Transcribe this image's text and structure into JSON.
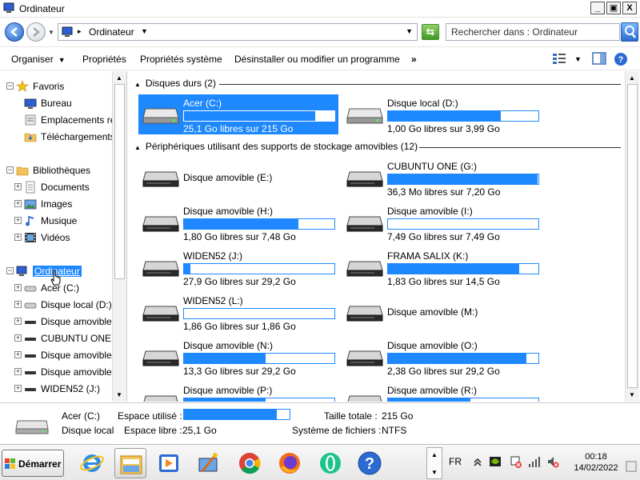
{
  "window": {
    "title": "Ordinateur",
    "minimize": "_",
    "maximize": "▣",
    "close": "X"
  },
  "address": {
    "location": "Ordinateur",
    "search_placeholder": "Rechercher dans : Ordinateur"
  },
  "toolbar": {
    "organize": "Organiser",
    "properties": "Propriétés",
    "system_properties": "Propriétés système",
    "uninstall": "Désinstaller ou modifier un programme",
    "more": "»"
  },
  "nav": {
    "favorites": "Favoris",
    "desktop": "Bureau",
    "recent": "Emplacements récents",
    "downloads": "Téléchargements",
    "libraries": "Bibliothèques",
    "documents": "Documents",
    "images": "Images",
    "music": "Musique",
    "videos": "Vidéos",
    "computer": "Ordinateur",
    "drives": [
      "Acer (C:)",
      "Disque local (D:)",
      "Disque amovible (E:)",
      "CUBUNTU ONE (G:)",
      "Disque amovible (H:)",
      "Disque amovible (I:)",
      "WIDEN52 (J:)"
    ]
  },
  "groups": {
    "hard_disks": "Disques durs (2)",
    "removable": "Périphériques utilisant des supports de stockage amovibles (12)"
  },
  "drives": [
    {
      "name": "Acer (C:)",
      "free": "25,1 Go libres sur 215 Go",
      "used_fraction": 0.88,
      "selected": true
    },
    {
      "name": "Disque local (D:)",
      "free": "1,00 Go libres sur 3,99 Go",
      "used_fraction": 0.75
    },
    {
      "name": "Disque amovible (E:)",
      "free": "",
      "used_fraction": null
    },
    {
      "name": "CUBUNTU ONE (G:)",
      "free": "36,3 Mo libres sur 7,20 Go",
      "used_fraction": 0.995
    },
    {
      "name": "Disque amovible (H:)",
      "free": "1,80 Go libres sur 7,48 Go",
      "used_fraction": 0.76
    },
    {
      "name": "Disque amovible (I:)",
      "free": "7,49 Go libres sur 7,49 Go",
      "used_fraction": 0.0
    },
    {
      "name": "WIDEN52 (J:)",
      "free": "27,9 Go libres sur 29,2 Go",
      "used_fraction": 0.045
    },
    {
      "name": "FRAMA SALIX (K:)",
      "free": "1,83 Go libres sur 14,5 Go",
      "used_fraction": 0.87
    },
    {
      "name": "WIDEN52 (L:)",
      "free": "1,86 Go libres sur 1,86 Go",
      "used_fraction": 0.0
    },
    {
      "name": "Disque amovible (M:)",
      "free": "",
      "used_fraction": null
    },
    {
      "name": "Disque amovible (N:)",
      "free": "13,3 Go libres sur 29,2 Go",
      "used_fraction": 0.54
    },
    {
      "name": "Disque amovible (O:)",
      "free": "2,38 Go libres sur 29,2 Go",
      "used_fraction": 0.92
    },
    {
      "name": "Disque amovible (P:)",
      "free": "",
      "used_fraction": 0.54
    },
    {
      "name": "Disque amovible (R:)",
      "free": "",
      "used_fraction": 0.55
    }
  ],
  "details": {
    "name": "Acer (C:)",
    "type": "Disque local",
    "used_label": "Espace utilisé :",
    "used_fraction": 0.88,
    "free_label": "Espace libre :",
    "free_value": "25,1 Go",
    "size_label": "Taille totale :",
    "size_value": "215 Go",
    "fs_label": "Système de fichiers :",
    "fs_value": "NTFS"
  },
  "taskbar": {
    "start": "Démarrer",
    "lang": "FR",
    "time": "00:18",
    "date": "14/02/2022"
  },
  "colors": {
    "accent": "#1e88ff"
  }
}
